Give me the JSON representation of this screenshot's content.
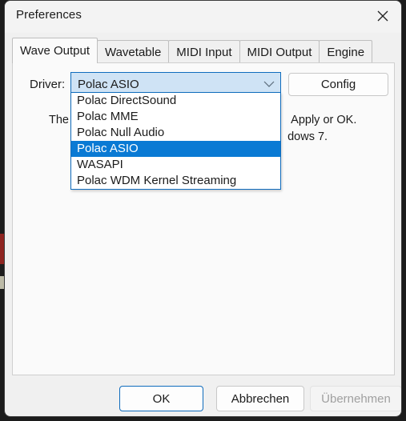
{
  "window": {
    "title": "Preferences",
    "close_icon": "close-icon"
  },
  "tabs": [
    {
      "label": "Wave Output",
      "active": true
    },
    {
      "label": "Wavetable",
      "active": false
    },
    {
      "label": "MIDI Input",
      "active": false
    },
    {
      "label": "MIDI Output",
      "active": false
    },
    {
      "label": "Engine",
      "active": false
    }
  ],
  "wave_output": {
    "driver_label": "Driver:",
    "driver_value": "Polac ASIO",
    "driver_arrow_icon": "chevron-down-icon",
    "config_label": "Config",
    "description_line1": "The                                                                     Apply or OK.",
    "description_line2": "                                                                          dows 7."
  },
  "driver_dropdown": {
    "options": [
      "Polac DirectSound",
      "Polac MME",
      "Polac Null Audio",
      "Polac ASIO",
      "WASAPI",
      "Polac WDM Kernel Streaming"
    ],
    "selected": "Polac ASIO"
  },
  "footer": {
    "ok_label": "OK",
    "cancel_label": "Abbrechen",
    "apply_label": "Übernehmen"
  },
  "colors": {
    "accent": "#0a7ad4",
    "focus_border": "#0f6cbd",
    "combo_fill": "#cfe3f5",
    "dialog_bg": "#f0f0f0",
    "panel_bg": "#fafafa",
    "desktop_bg": "#1c1c1c"
  }
}
